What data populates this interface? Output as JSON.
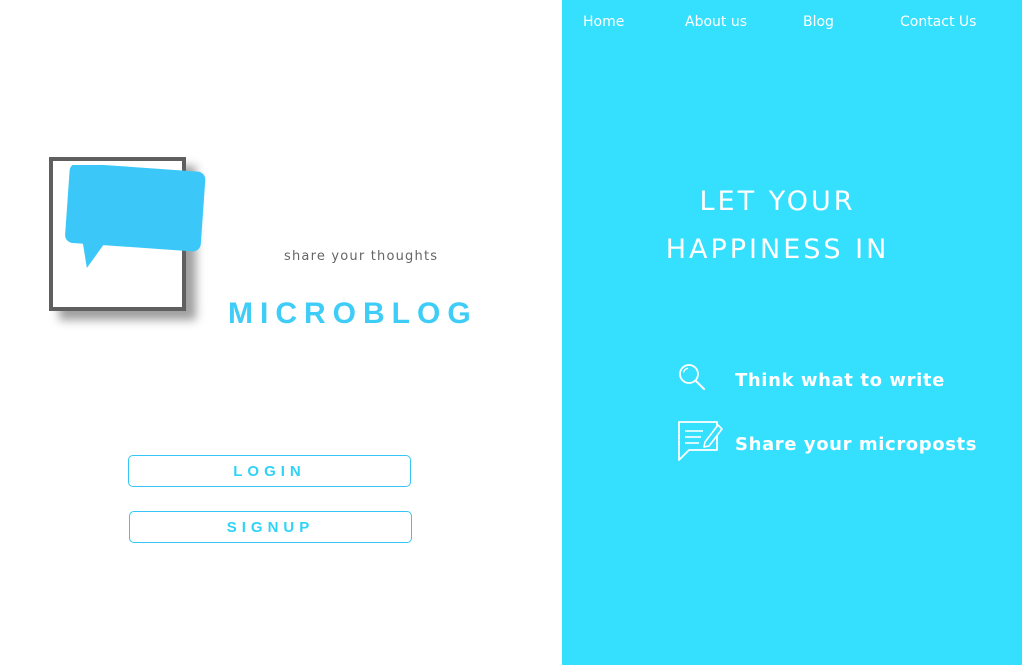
{
  "nav": {
    "home": "Home",
    "about": "About us",
    "blog": "Blog",
    "contact": "Contact Us"
  },
  "brand": {
    "tagline": "share your thoughts",
    "name": "MICROBLOG"
  },
  "buttons": {
    "login": "LOGIN",
    "signup": "SIGNUP"
  },
  "hero": {
    "line1": "LET YOUR",
    "line2": "HAPPINESS IN"
  },
  "features": [
    {
      "icon": "search-icon",
      "label": "Think what to write"
    },
    {
      "icon": "message-edit-icon",
      "label": "Share your microposts"
    }
  ],
  "colors": {
    "accent": "#35e0ff",
    "brand": "#3fcdf8",
    "frame": "#5f5f5f",
    "tagline": "#666666"
  }
}
